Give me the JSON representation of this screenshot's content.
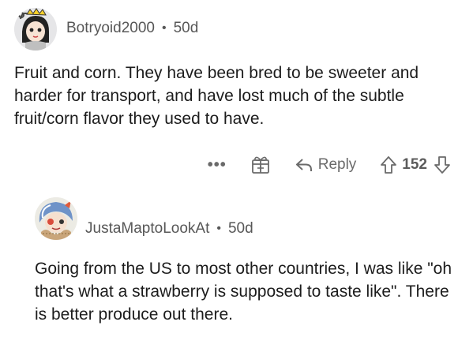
{
  "comments": [
    {
      "username": "Botryoid2000",
      "separator": "•",
      "age": "50d",
      "text": "Fruit and corn. They have been bred to be sweeter and harder for transport, and have lost much of the subtle fruit/corn flavor they used to have.",
      "actions": {
        "more_label": "•••",
        "reply_label": "Reply",
        "vote_count": "152"
      },
      "icons": [
        "avatar",
        "award-icon",
        "reply-icon",
        "upvote-icon",
        "downvote-icon"
      ]
    },
    {
      "username": "JustaMaptoLookAt",
      "separator": "•",
      "age": "50d",
      "text": "Going from the US to most other countries, I was like \"oh that's what a strawberry is supposed to taste like\". There is better produce out there."
    }
  ],
  "colors": {
    "meta_text": "#575757",
    "body_text": "#1c1c1c",
    "action_text": "#6a6a6a"
  }
}
